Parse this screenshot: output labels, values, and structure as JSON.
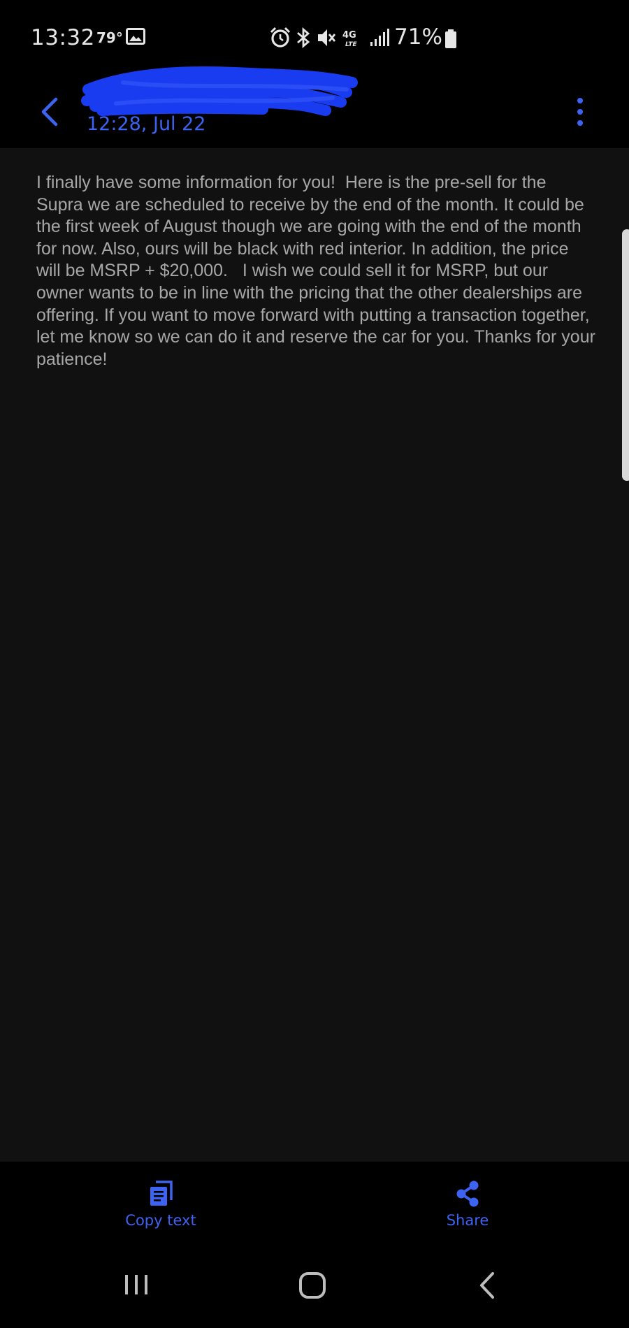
{
  "status_bar": {
    "time": "13:32",
    "temperature": "79°",
    "network": "4G LTE",
    "battery": "71%",
    "icons": [
      "gallery-icon",
      "alarm-icon",
      "bluetooth-icon",
      "mute-icon",
      "lte-icon",
      "signal-icon",
      "battery-icon"
    ]
  },
  "header": {
    "contact_name_redacted": true,
    "timestamp": "12:28, Jul 22",
    "accent_color": "#3d63f2",
    "redaction_color": "#1a3cf0"
  },
  "message": {
    "text": "I finally have some information for you!  Here is the pre-sell for the Supra we are scheduled to receive by the end of the month. It could be the first week of August though we are going with the end of the month for now. Also, ours will be black with red interior. In addition, the price will be MSRP + $20,000.   I wish we could sell it for MSRP, but our owner wants to be in line with the pricing that the other dealerships are offering. If you want to move forward with putting a transaction together, let me know so we can do it and reserve the car for you. Thanks for your patience!"
  },
  "actions": {
    "copy_label": "Copy text",
    "share_label": "Share"
  },
  "nav": {
    "buttons": [
      "recents",
      "home",
      "back"
    ]
  }
}
